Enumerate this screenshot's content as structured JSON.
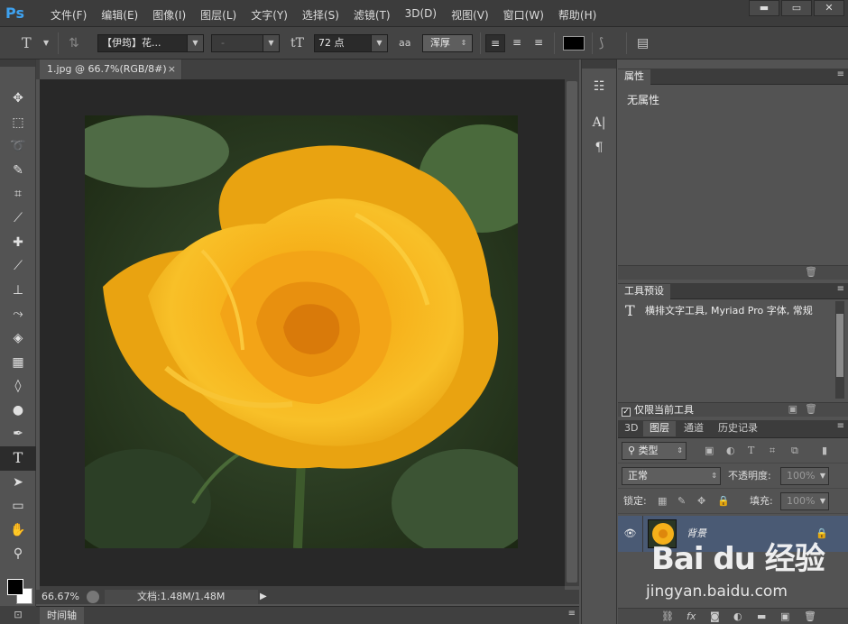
{
  "app": {
    "logo": "Ps",
    "menu": [
      "文件(F)",
      "编辑(E)",
      "图像(I)",
      "图层(L)",
      "文字(Y)",
      "选择(S)",
      "滤镜(T)",
      "3D(D)",
      "视图(V)",
      "窗口(W)",
      "帮助(H)"
    ],
    "window_controls": {
      "minimize": "▬",
      "restore": "▭",
      "close": "✕"
    }
  },
  "options": {
    "tool_icon": "T",
    "font_family": "【伊筠】花...",
    "font_style": "-",
    "size_icon": "tT",
    "font_size": "72 点",
    "aa_icon": "aa",
    "antialias": "浑厚",
    "text_color": "#000000"
  },
  "document": {
    "tab_title": "1.jpg @ 66.7%(RGB/8#)",
    "tab_close": "×",
    "zoom": "66.67%",
    "doc_size": "文档:1.48M/1.48M",
    "timeline_tab": "时间轴"
  },
  "toolbar": {
    "active_tool": "type-tool",
    "fg_color": "#000000",
    "bg_color": "#ffffff"
  },
  "properties": {
    "tab": "属性",
    "empty_text": "无属性"
  },
  "presets": {
    "tab": "工具预设",
    "item": "横排文字工具, Myriad Pro 字体, 常规",
    "current_only_label": "仅限当前工具",
    "checked": true
  },
  "layers": {
    "tabs": [
      "3D",
      "图层",
      "通道",
      "历史记录"
    ],
    "active_tab": "图层",
    "filter_kind": "类型",
    "blend_mode": "正常",
    "opacity_label": "不透明度:",
    "opacity_value": "100%",
    "lock_label": "锁定:",
    "fill_label": "填充:",
    "fill_value": "100%",
    "layer_name": "背景"
  },
  "watermark": {
    "logo": "Bai du 经验",
    "url": "jingyan.baidu.com"
  },
  "colors": {
    "rose": "#f5b21a",
    "leaf": "#2f4a2a",
    "layer_selected": "#4a5a74"
  }
}
